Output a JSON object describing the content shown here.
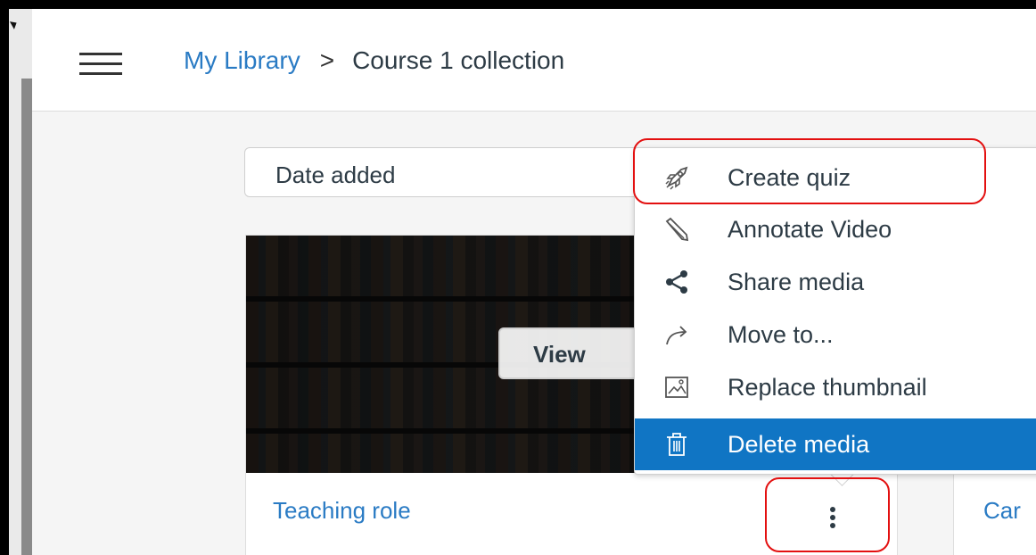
{
  "header": {
    "menu_icon": "hamburger-menu-icon",
    "breadcrumb": {
      "root": "My Library",
      "separator": ">",
      "current": "Course 1 collection"
    }
  },
  "toolbar": {
    "sort_value": "Date added"
  },
  "cards": [
    {
      "view_label": "View",
      "title": "Teaching role",
      "menu_icon": "vertical-ellipsis-icon"
    },
    {
      "title": "Car"
    }
  ],
  "context_menu": {
    "items": [
      {
        "label": "Create quiz",
        "icon": "rocket-icon"
      },
      {
        "label": "Annotate Video",
        "icon": "pencil-icon"
      },
      {
        "label": "Share media",
        "icon": "share-icon"
      },
      {
        "label": "Move to...",
        "icon": "arrow-forward-icon"
      },
      {
        "label": "Replace thumbnail",
        "icon": "image-icon"
      },
      {
        "label": "Delete media",
        "icon": "trash-icon"
      }
    ],
    "active_index": 5
  },
  "colors": {
    "link": "#2a7bc4",
    "text": "#2d3b45",
    "active_bg": "#1075c4",
    "highlight": "#e31010"
  }
}
